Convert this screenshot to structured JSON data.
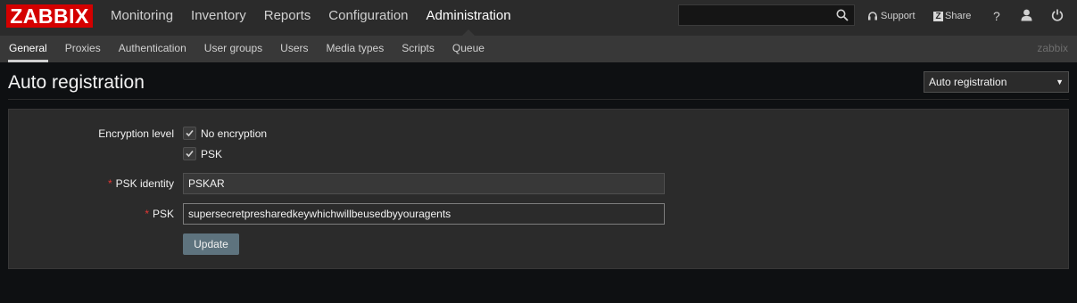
{
  "app": {
    "logo": "ZABBIX",
    "server_name": "zabbix"
  },
  "main_menu": [
    {
      "label": "Monitoring",
      "active": false
    },
    {
      "label": "Inventory",
      "active": false
    },
    {
      "label": "Reports",
      "active": false
    },
    {
      "label": "Configuration",
      "active": false
    },
    {
      "label": "Administration",
      "active": true
    }
  ],
  "search": {
    "value": "",
    "placeholder": ""
  },
  "top_right": {
    "support_label": "Support",
    "share_label": "Share",
    "share_badge": "Z",
    "help_label": "?"
  },
  "sub_menu": [
    {
      "label": "General",
      "active": true
    },
    {
      "label": "Proxies",
      "active": false
    },
    {
      "label": "Authentication",
      "active": false
    },
    {
      "label": "User groups",
      "active": false
    },
    {
      "label": "Users",
      "active": false
    },
    {
      "label": "Media types",
      "active": false
    },
    {
      "label": "Scripts",
      "active": false
    },
    {
      "label": "Queue",
      "active": false
    }
  ],
  "page": {
    "title": "Auto registration",
    "selector_value": "Auto registration"
  },
  "form": {
    "encryption_label": "Encryption level",
    "no_encryption_label": "No encryption",
    "no_encryption_checked": true,
    "psk_label": "PSK",
    "psk_checked": true,
    "psk_identity_label": "PSK identity",
    "psk_identity_value": "PSKAR",
    "psk_field_label": "PSK",
    "psk_value": "supersecretpresharedkeywhichwillbeusedbyyouragents",
    "required_mark": "*",
    "update_label": "Update"
  },
  "colors": {
    "logo_bg": "#d40000",
    "update_button": "#5e737e",
    "required": "#e33734"
  }
}
